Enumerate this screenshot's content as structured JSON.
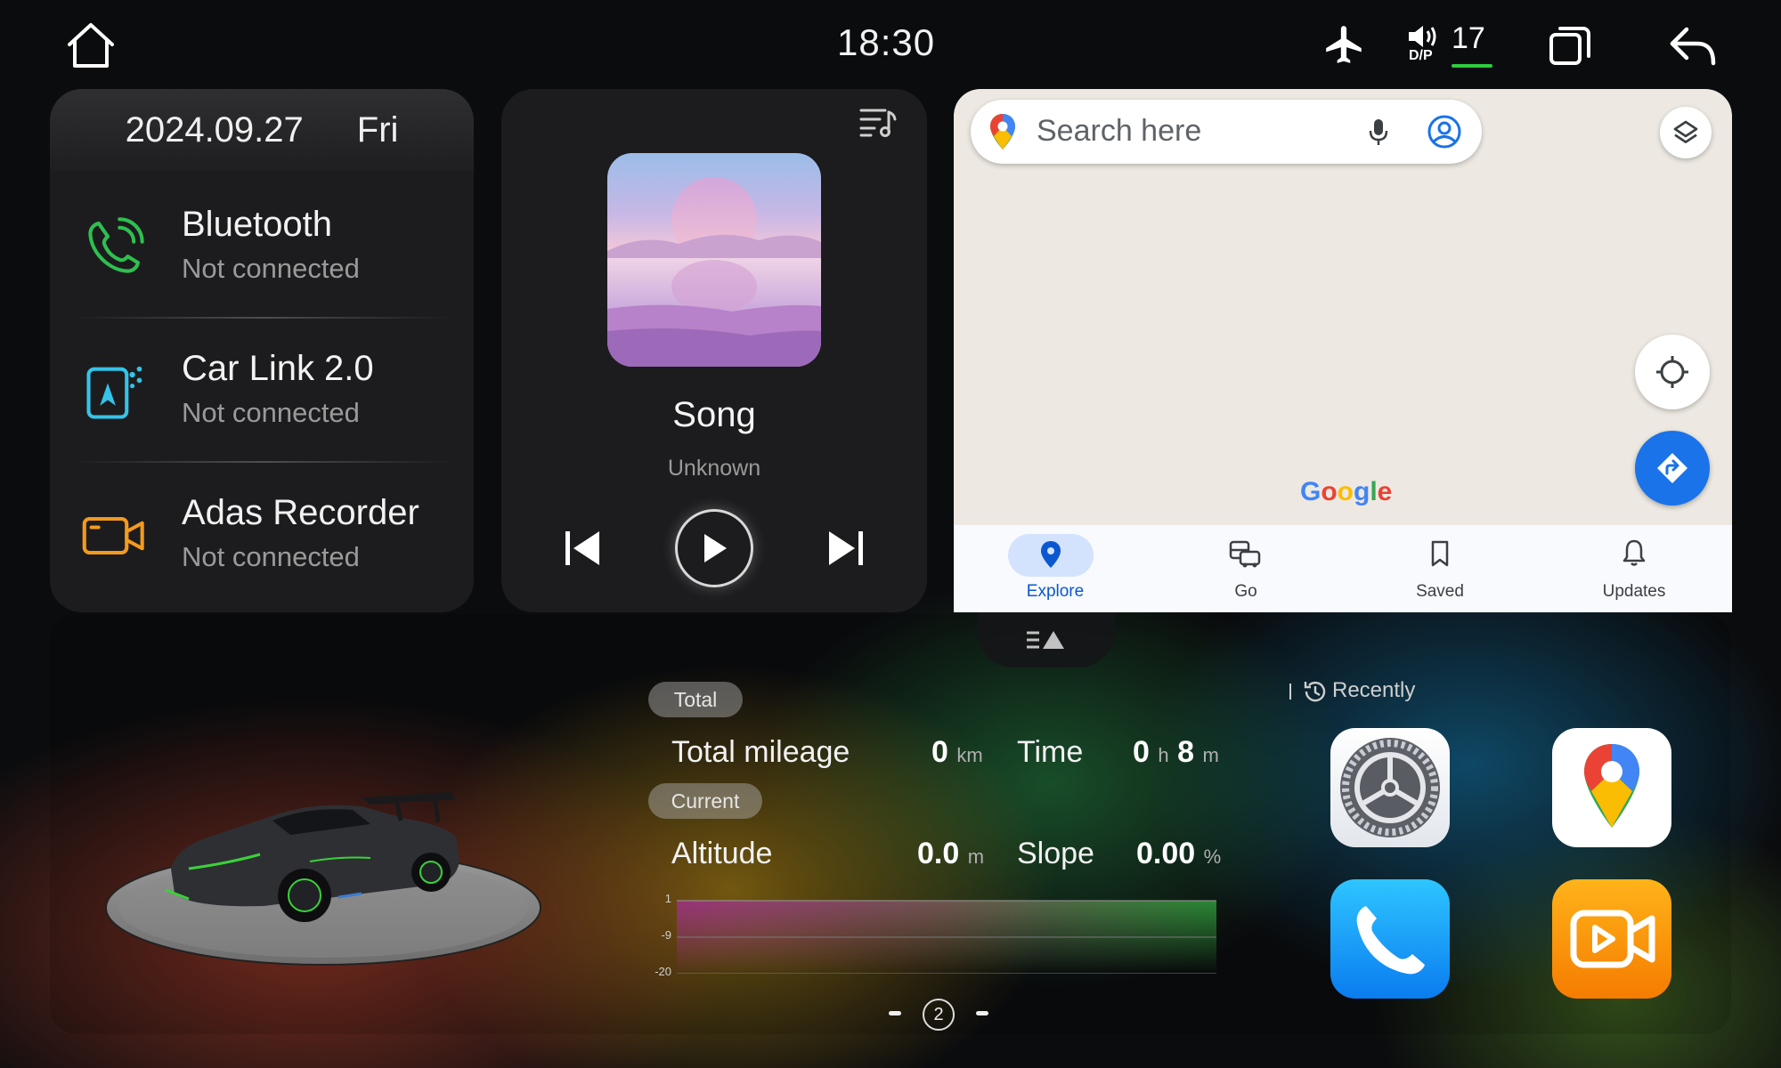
{
  "status_bar": {
    "time": "18:30",
    "volume_label": "D/P",
    "volume_level": "17"
  },
  "date_card": {
    "date": "2024.09.27",
    "weekday": "Fri"
  },
  "connections": [
    {
      "title": "Bluetooth",
      "status": "Not connected",
      "icon": "phone-icon",
      "color": "#2fbf4f"
    },
    {
      "title": "Car Link 2.0",
      "status": "Not connected",
      "icon": "carlink-icon",
      "color": "#35c3e8"
    },
    {
      "title": "Adas Recorder",
      "status": "Not connected",
      "icon": "camera-icon",
      "color": "#f39a1e"
    }
  ],
  "music": {
    "title": "Song",
    "artist": "Unknown"
  },
  "map": {
    "search_placeholder": "Search here",
    "logo": "Google",
    "nav": [
      {
        "label": "Explore",
        "icon": "location-pin-icon",
        "active": true
      },
      {
        "label": "Go",
        "icon": "commute-icon",
        "active": false
      },
      {
        "label": "Saved",
        "icon": "bookmark-icon",
        "active": false
      },
      {
        "label": "Updates",
        "icon": "bell-icon",
        "active": false
      }
    ]
  },
  "trip": {
    "total_tag": "Total",
    "current_tag": "Current",
    "mileage_label": "Total mileage",
    "mileage_value": "0",
    "mileage_unit": "km",
    "time_label": "Time",
    "time_hours": "0",
    "time_hours_unit": "h",
    "time_minutes": "8",
    "time_minutes_unit": "m",
    "altitude_label": "Altitude",
    "altitude_value": "0.0",
    "altitude_unit": "m",
    "slope_label": "Slope",
    "slope_value": "0.00",
    "slope_unit": "%",
    "chart_ticks": [
      "1",
      "-9",
      "-20"
    ]
  },
  "recent": {
    "label": "Recently",
    "apps": [
      {
        "name": "Settings",
        "icon": "settings-gear-icon"
      },
      {
        "name": "Maps",
        "icon": "maps-pin-icon"
      },
      {
        "name": "Phone",
        "icon": "phone-icon"
      },
      {
        "name": "Video",
        "icon": "video-camera-icon"
      }
    ]
  },
  "pager": {
    "current_page": "2"
  }
}
